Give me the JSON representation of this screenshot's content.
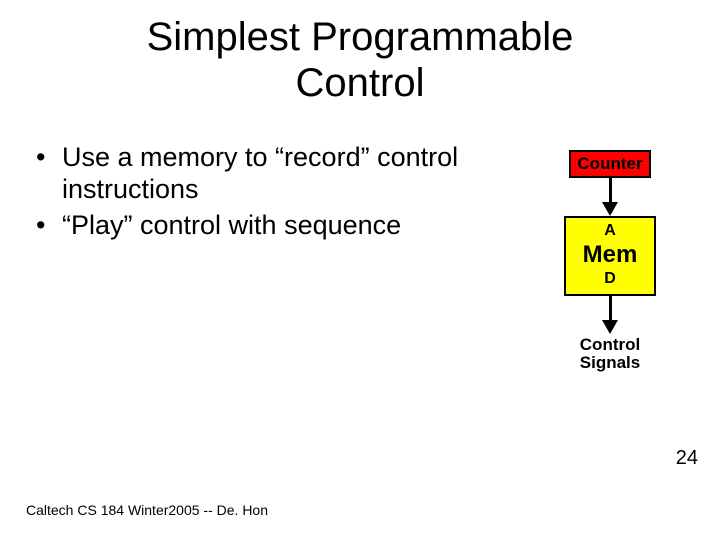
{
  "title": {
    "line1": "Simplest Programmable",
    "line2": "Control"
  },
  "bullets": [
    "Use a memory to “record” control instructions",
    "“Play” control with sequence"
  ],
  "diagram": {
    "counter": "Counter",
    "mem_a": "A",
    "mem_label": "Mem",
    "mem_d": "D",
    "signals_line1": "Control",
    "signals_line2": "Signals"
  },
  "footer": "Caltech CS 184 Winter2005 -- De. Hon",
  "page_number": "24"
}
